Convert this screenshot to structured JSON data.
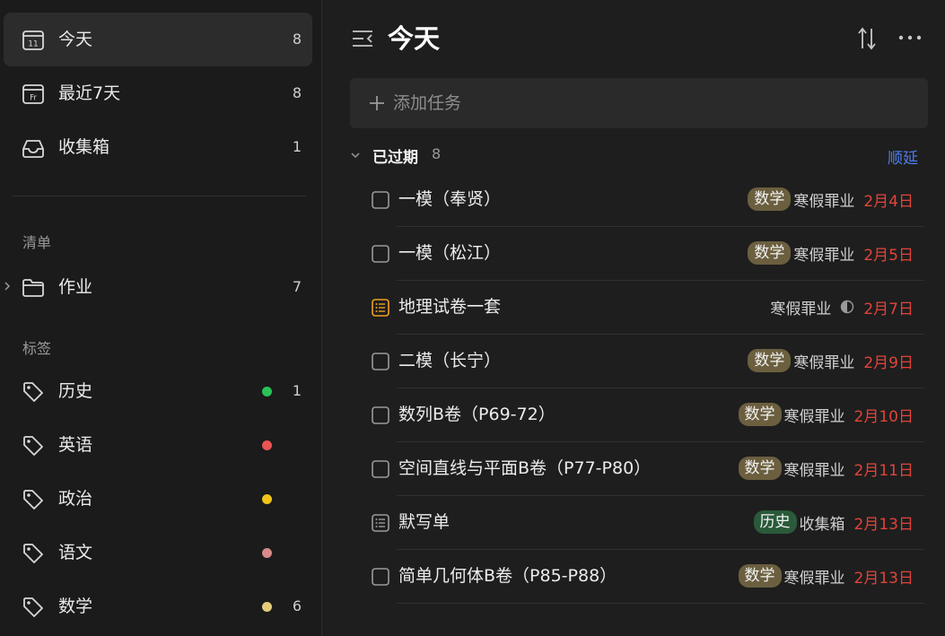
{
  "sidebar": {
    "smart_lists": [
      {
        "label": "今天",
        "count": "8",
        "icon": "calendar-today-icon",
        "icon_text": "11",
        "active": true
      },
      {
        "label": "最近7天",
        "count": "8",
        "icon": "calendar-week-icon",
        "icon_text": "Fr",
        "active": false
      },
      {
        "label": "收集箱",
        "count": "1",
        "icon": "inbox-icon",
        "active": false
      }
    ],
    "lists_title": "清单",
    "lists": [
      {
        "label": "作业",
        "count": "7",
        "icon": "folder-icon"
      }
    ],
    "tags_title": "标签",
    "tags": [
      {
        "label": "历史",
        "count": "1",
        "color": "#2bc257"
      },
      {
        "label": "英语",
        "count": "",
        "color": "#ec5353"
      },
      {
        "label": "政治",
        "count": "",
        "color": "#f0c419"
      },
      {
        "label": "语文",
        "count": "",
        "color": "#d68a8a"
      },
      {
        "label": "数学",
        "count": "6",
        "color": "#e3cd7a"
      }
    ]
  },
  "main": {
    "title": "今天",
    "add_placeholder": "添加任务",
    "group": {
      "title": "已过期",
      "count": "8",
      "action": "顺延"
    },
    "tasks": [
      {
        "title": "一模（奉贤）",
        "tag": "数学",
        "tag_color": "#6b5f3f",
        "list": "寒假罪业",
        "date": "2月4日",
        "type": "checkbox"
      },
      {
        "title": "一模（松江）",
        "tag": "数学",
        "tag_color": "#6b5f3f",
        "list": "寒假罪业",
        "date": "2月5日",
        "type": "checkbox"
      },
      {
        "title": "地理试卷一套",
        "tag": "",
        "tag_color": "",
        "list": "寒假罪业",
        "date": "2月7日",
        "type": "checklist-orange",
        "progress_icon": true
      },
      {
        "title": "二模（长宁）",
        "tag": "数学",
        "tag_color": "#6b5f3f",
        "list": "寒假罪业",
        "date": "2月9日",
        "type": "checkbox"
      },
      {
        "title": "数列B卷（P69-72）",
        "tag": "数学",
        "tag_color": "#6b5f3f",
        "list": "寒假罪业",
        "date": "2月10日",
        "type": "checkbox"
      },
      {
        "title": "空间直线与平面B卷（P77-P80）",
        "tag": "数学",
        "tag_color": "#6b5f3f",
        "list": "寒假罪业",
        "date": "2月11日",
        "type": "checkbox"
      },
      {
        "title": "默写单",
        "tag": "历史",
        "tag_color": "#2a5a3a",
        "list": "收集箱",
        "date": "2月13日",
        "type": "checklist-gray"
      },
      {
        "title": "简单几何体B卷（P85-P88）",
        "tag": "数学",
        "tag_color": "#6b5f3f",
        "list": "寒假罪业",
        "date": "2月13日",
        "type": "checkbox"
      }
    ]
  }
}
